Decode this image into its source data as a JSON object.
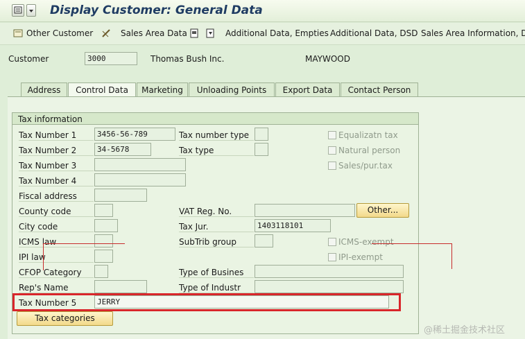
{
  "window": {
    "title": "Display Customer: General Data"
  },
  "toolbar": {
    "other_customer": "Other Customer",
    "sales_area_data": "Sales Area Data",
    "additional_data_empties": "Additional Data, Empties",
    "additional_data_dsd": "Additional Data, DSD",
    "sales_area_information_dsd": "Sales Area Information, DSD"
  },
  "header": {
    "customer_label": "Customer",
    "customer_value": "3000",
    "customer_name": "Thomas Bush Inc.",
    "city": "MAYWOOD"
  },
  "tabs": [
    {
      "label": "Address"
    },
    {
      "label": "Control Data"
    },
    {
      "label": "Marketing"
    },
    {
      "label": "Unloading Points"
    },
    {
      "label": "Export Data"
    },
    {
      "label": "Contact Person"
    }
  ],
  "tax": {
    "group_title": "Tax information",
    "tax_number_1": {
      "label": "Tax Number 1",
      "value": "3456-56-789"
    },
    "tax_number_2": {
      "label": "Tax Number 2",
      "value": "34-5678"
    },
    "tax_number_3": {
      "label": "Tax Number 3",
      "value": ""
    },
    "tax_number_4": {
      "label": "Tax Number 4",
      "value": ""
    },
    "fiscal_address": {
      "label": "Fiscal address",
      "value": ""
    },
    "county_code": {
      "label": "County code",
      "value": ""
    },
    "city_code": {
      "label": "City code",
      "value": ""
    },
    "icms_law": {
      "label": "ICMS law",
      "value": ""
    },
    "ipi_law": {
      "label": "IPI law",
      "value": ""
    },
    "cfop_category": {
      "label": "CFOP Category",
      "value": ""
    },
    "reps_name": {
      "label": "Rep's Name",
      "value": ""
    },
    "tax_number_5": {
      "label": "Tax Number 5",
      "value": "JERRY"
    },
    "tax_number_type": {
      "label": "Tax number type",
      "value": ""
    },
    "tax_type": {
      "label": "Tax type",
      "value": ""
    },
    "vat_reg_no": {
      "label": "VAT Reg. No.",
      "value": ""
    },
    "tax_jur": {
      "label": "Tax Jur.",
      "value": "1403118101"
    },
    "subtrib_group": {
      "label": "SubTrib group",
      "value": ""
    },
    "type_of_business": {
      "label": "Type of Busines",
      "value": ""
    },
    "type_of_industry": {
      "label": "Type of Industr",
      "value": ""
    },
    "equalization_tax": "Equalizatn tax",
    "natural_person": "Natural person",
    "sales_pur_tax": "Sales/pur.tax",
    "icms_exempt": "ICMS-exempt",
    "ipi_exempt": "IPI-exempt",
    "other_button": "Other...",
    "tax_categories_button": "Tax categories"
  },
  "watermark": "@稀土掘金技术社区"
}
